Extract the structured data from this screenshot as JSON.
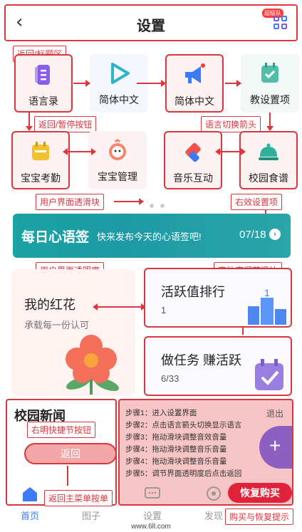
{
  "header": {
    "title": "设置",
    "badge": "超级队"
  },
  "annotations": {
    "back_title": "返回/标题区",
    "back_pause": "返回/暂停按钮",
    "lang_arrow": "语言切换箭头",
    "ui_slider": "用户界面透滑块",
    "right_effect": "右效设置项",
    "ui_opacity": "用户界面透明度",
    "sfx_slider": "音效度调节滑块",
    "shortcut": "右明快捷节按钮",
    "main_menu": "返回主菜单按单",
    "buy_restore": "购买与恢复提示"
  },
  "tiles": {
    "t1": "语言录",
    "t2": "简体中文",
    "t3": "简体中文",
    "t4": "教设置项",
    "t5": "宝宝考勤",
    "t6": "宝宝管理",
    "t7": "音乐互动",
    "t8": "校园食谱"
  },
  "banner": {
    "logo": "每日心语签",
    "text": "快来发布今天的心语签吧!",
    "page": "07/18"
  },
  "cards": {
    "flower_title": "我的红花",
    "flower_sub": "承载每一份认可",
    "rank_title": "活跃值排行",
    "rank_value": "1",
    "task_title": "做任务 赚活跃",
    "task_value": "6/33"
  },
  "news": {
    "title": "校园新闻",
    "return_label": "返回"
  },
  "steps": {
    "exit": "退出",
    "items": [
      "步骤1：进入设置界面",
      "步骤2：点击语言箭头切换显示语言",
      "步骤3：拖动滑块调整音效音量",
      "步骤4：拖动滑块调整音乐音量",
      "步骤4：拖动滑块调整音乐音量",
      "步骤5：调节界面透明度后点击返回"
    ],
    "fab": "+",
    "buy": "恢复购买"
  },
  "tabs": [
    "首页",
    "图子",
    "设置",
    "发现"
  ],
  "footer": {
    "url": "www.6ll.com"
  },
  "colors": {
    "accent": "#d9363e",
    "teal": "#1aa3a3",
    "purple": "#8e5fc2",
    "blue": "#3c7bf6"
  }
}
